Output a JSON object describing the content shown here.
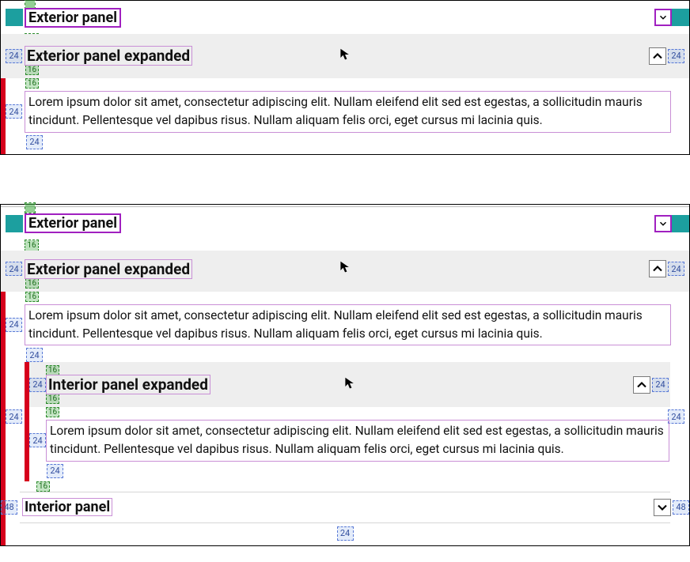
{
  "measurements": {
    "m24": "24",
    "m48": "48",
    "m16": "16"
  },
  "block1": {
    "collapsed_title": "Exterior panel",
    "expanded_title": "Exterior panel expanded",
    "body": "Lorem ipsum dolor sit amet, consectetur adipiscing elit. Nullam eleifend elit sed est egestas, a sollicitudin mauris tincidunt. Pellentesque vel dapibus risus. Nullam aliquam felis orci, eget cursus mi lacinia quis."
  },
  "block2": {
    "collapsed_title": "Exterior panel",
    "expanded_title": "Exterior panel expanded",
    "body": "Lorem ipsum dolor sit amet, consectetur adipiscing elit. Nullam eleifend elit sed est egestas, a sollicitudin mauris tincidunt. Pellentesque vel dapibus risus. Nullam aliquam felis orci, eget cursus mi lacinia quis.",
    "interior_expanded_title": "Interior panel expanded",
    "interior_body": "Lorem ipsum dolor sit amet, consectetur adipiscing elit. Nullam eleifend elit sed est egestas, a sollicitudin mauris tincidunt. Pellentesque vel dapibus risus. Nullam aliquam felis orci, eget cursus mi lacinia quis.",
    "interior_collapsed_title": "Interior panel"
  }
}
